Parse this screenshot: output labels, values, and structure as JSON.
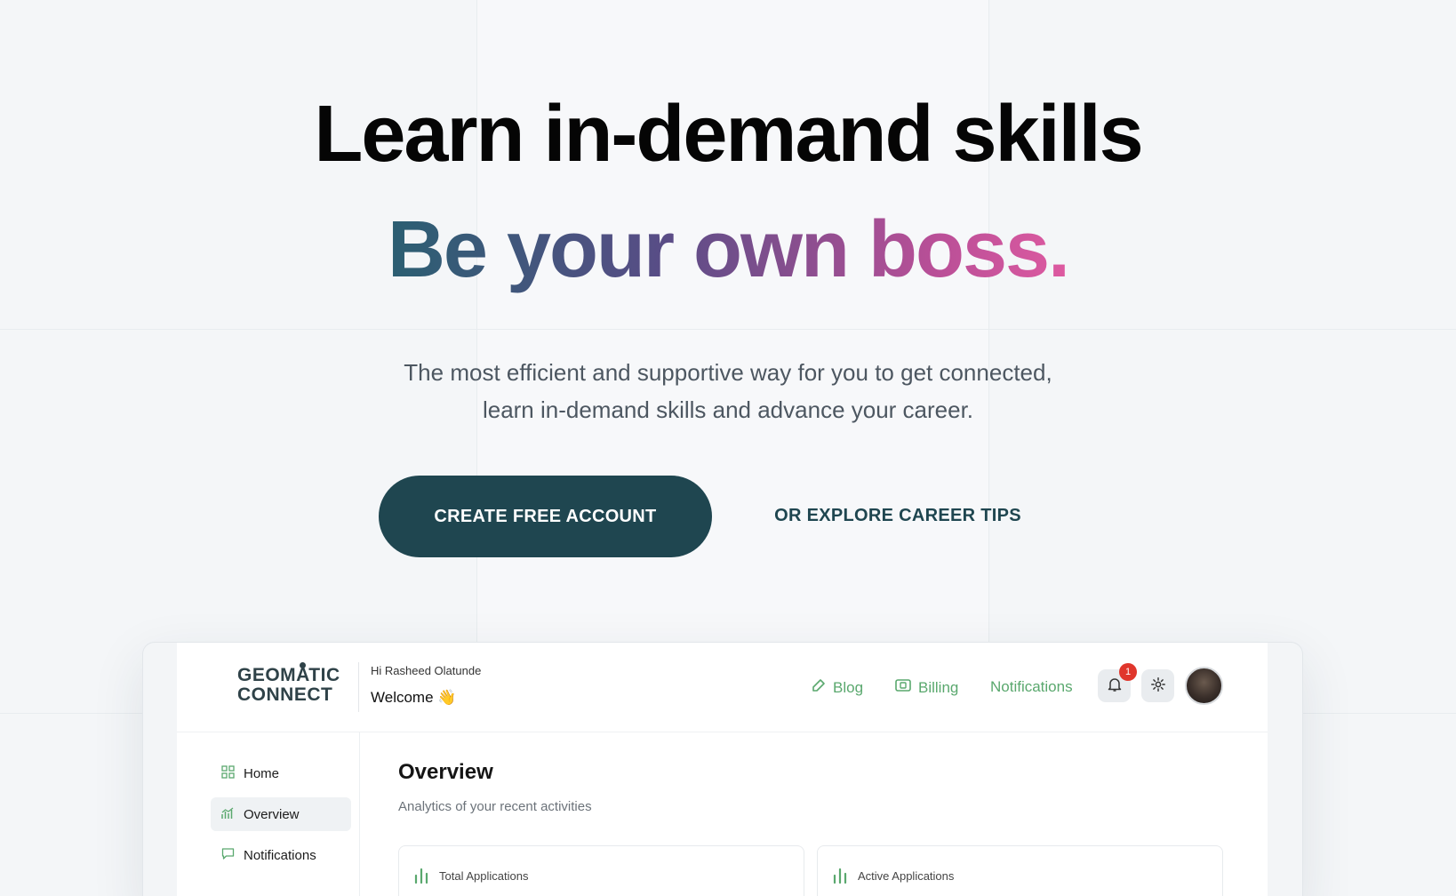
{
  "hero": {
    "headline": "Learn in-demand skills",
    "subheadline": "Be your own boss.",
    "lead_line1": "The most efficient and supportive way for you to get connected,",
    "lead_line2": "learn in-demand skills and advance your career.",
    "cta_primary": "CREATE FREE ACCOUNT",
    "cta_secondary": "OR EXPLORE CAREER TIPS"
  },
  "colors": {
    "primary": "#1f4650",
    "accent_green": "#5aa86e",
    "gradient_start": "#2b5f72",
    "gradient_end": "#de5aa1",
    "badge": "#e0362c"
  },
  "app": {
    "logo_line1": "GEOMATIC",
    "logo_line2": "CONNECT",
    "greeting": "Hi Rasheed Olatunde",
    "welcome": "Welcome 👋",
    "nav": [
      {
        "label": "Blog",
        "icon": "pencil-icon"
      },
      {
        "label": "Billing",
        "icon": "billing-icon"
      },
      {
        "label": "Notifications",
        "icon": ""
      }
    ],
    "notification_count": "1",
    "sidebar": [
      {
        "label": "Home",
        "icon": "grid-icon"
      },
      {
        "label": "Overview",
        "icon": "chart-icon",
        "active": true
      },
      {
        "label": "Notifications",
        "icon": "message-icon"
      }
    ],
    "main": {
      "title": "Overview",
      "subtitle": "Analytics of your recent activities",
      "cards": [
        {
          "label": "Total Applications",
          "icon": "bar-chart-icon"
        },
        {
          "label": "Active Applications",
          "icon": "bar-chart-icon"
        }
      ]
    }
  }
}
